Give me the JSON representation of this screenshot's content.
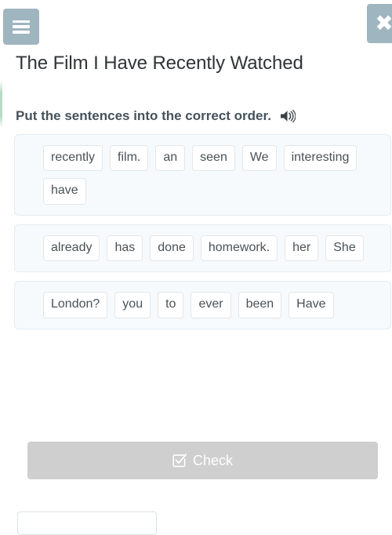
{
  "header": {
    "menu_icon": "hamburger-menu-icon",
    "close_icon": "close-x-icon",
    "title": "The Film I Have Recently Watched"
  },
  "instruction": {
    "text": "Put the sentences into the correct order.",
    "audio_icon": "speaker-icon"
  },
  "exercise": {
    "cards": [
      {
        "words": [
          "recently",
          "film.",
          "an",
          "seen",
          "We",
          "interesting",
          "have"
        ]
      },
      {
        "words": [
          "already",
          "has",
          "done",
          "homework.",
          "her",
          "She"
        ]
      },
      {
        "words": [
          "London?",
          "you",
          "to",
          "ever",
          "been",
          "Have"
        ]
      }
    ]
  },
  "actions": {
    "check_label": "Check",
    "check_icon": "checked-box-icon"
  },
  "colors": {
    "icon_button_bg": "#9fb5c0",
    "card_bg": "#f6fafc",
    "card_border": "#e4edf2",
    "chip_bg": "#ffffff",
    "chip_border": "#e3e7ea",
    "check_button_bg": "#cfcfcf",
    "title_text": "#2f3437",
    "instruction_text": "#46525c",
    "left_accent": "#a0cdaf"
  }
}
